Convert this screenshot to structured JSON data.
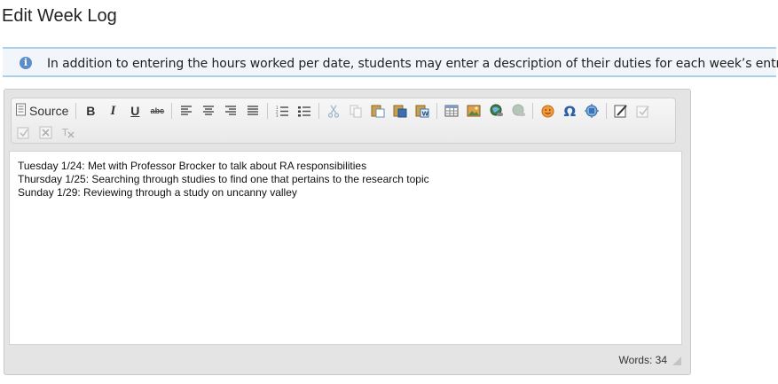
{
  "page": {
    "title": "Edit Week Log"
  },
  "info": {
    "icon": "info-icon",
    "text": "In addition to entering the hours worked per date, students may enter a description of their duties for each week’s entries."
  },
  "toolbar": {
    "source_label": "Source",
    "bold_label": "B",
    "italic_label": "I",
    "underline_label": "U",
    "strike_label": "abc",
    "icons": [
      "source-icon",
      "bold-icon",
      "italic-icon",
      "underline-icon",
      "strikethrough-icon",
      "align-left-icon",
      "align-center-icon",
      "align-right-icon",
      "align-justify-icon",
      "numbered-list-icon",
      "bulleted-list-icon",
      "cut-icon",
      "copy-icon",
      "paste-icon",
      "paste-text-icon",
      "paste-word-icon",
      "table-icon",
      "image-icon",
      "link-icon",
      "unlink-icon",
      "smiley-icon",
      "special-character-icon",
      "anchor-icon",
      "edit-icon",
      "spellcheck-icon",
      "check-icon",
      "remove-format-icon",
      "clear-format-icon"
    ]
  },
  "editor": {
    "lines": [
      "Tuesday 1/24: Met with Professor Brocker to talk about RA responsibilities",
      "Thursday 1/25: Searching through studies to find one that pertains to the research topic",
      "Sunday 1/29: Reviewing through a study on uncanny valley"
    ],
    "word_count": "Words: 34"
  },
  "colors": {
    "banner_border": "#a9d1ea",
    "banner_bg": "#f2f6fa",
    "info_icon": "#5b8fc7"
  }
}
